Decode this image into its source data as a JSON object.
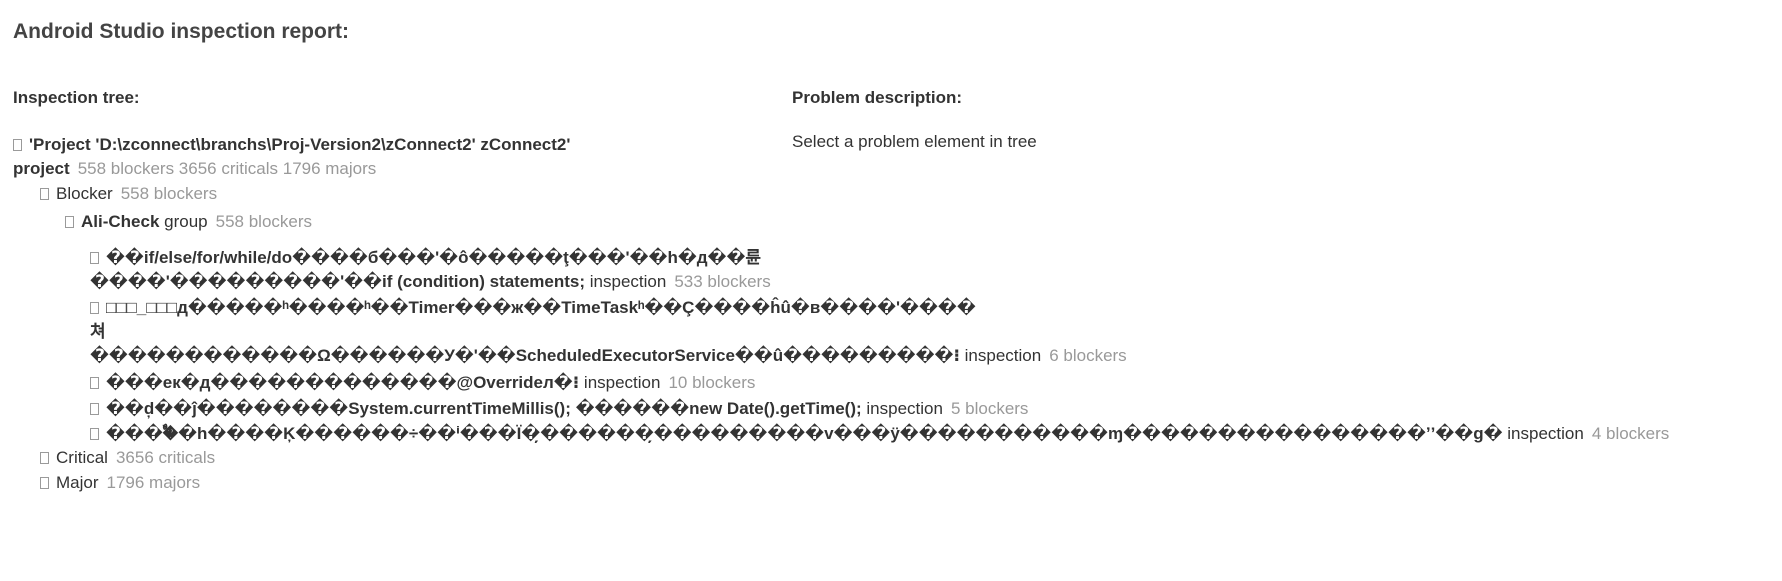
{
  "report": {
    "title": "Android Studio inspection report:",
    "tree_heading": "Inspection tree:",
    "description_heading": "Problem description:",
    "description_text": "Select a problem element in tree"
  },
  "tree": {
    "root": {
      "label_line1": "'Project 'D:\\zconnect\\branchs\\Proj-Version2\\zConnect2' zConnect2'",
      "label_line2": "project",
      "counts": "558 blockers 3656 criticals 1796 majors"
    },
    "blocker": {
      "label": "Blocker",
      "count": "558 blockers"
    },
    "ali_check": {
      "label_bold": "Ali-Check",
      "label_rest": " group",
      "count": "558 blockers"
    },
    "items": [
      {
        "line1": "��if/else/for/while/do����б���'�ô�����ţ���'��h�д��륜",
        "line2": "����'���������ʹ��if (condition) statements;",
        "tag": " inspection",
        "count": "533 blockers"
      },
      {
        "line1": "□□□_□□□д�����ʰ����ʰ��Timer���ж��TimeTaskʰ��Ç����ĥû�в����ʹ����",
        "line2": "쳐",
        "line3": "������������Ω������У�'��ScheduledExecutorService��û���������⁝",
        "tag": " inspection",
        "count": "6 blockers"
      },
      {
        "line1": "���ек�д�������������@Overrideл�⁝",
        "tag": " inspection",
        "count": "10 blockers"
      },
      {
        "line1": "��d̦��ĵ��������System.currentTimeMillis(); ������new Date().getTime();",
        "tag": " inspection",
        "count": "5 blockers"
      },
      {
        "line1": "����ࣨ�h����Ķ������÷��ⁱ���Ї�̦������̦���������v���ÿ�����������ɱ����������������ʼ’��g�",
        "tag": " inspection",
        "count": "4 blockers"
      }
    ],
    "critical": {
      "label": "Critical",
      "count": "3656 criticals"
    },
    "major": {
      "label": "Major",
      "count": "1796 majors"
    }
  }
}
